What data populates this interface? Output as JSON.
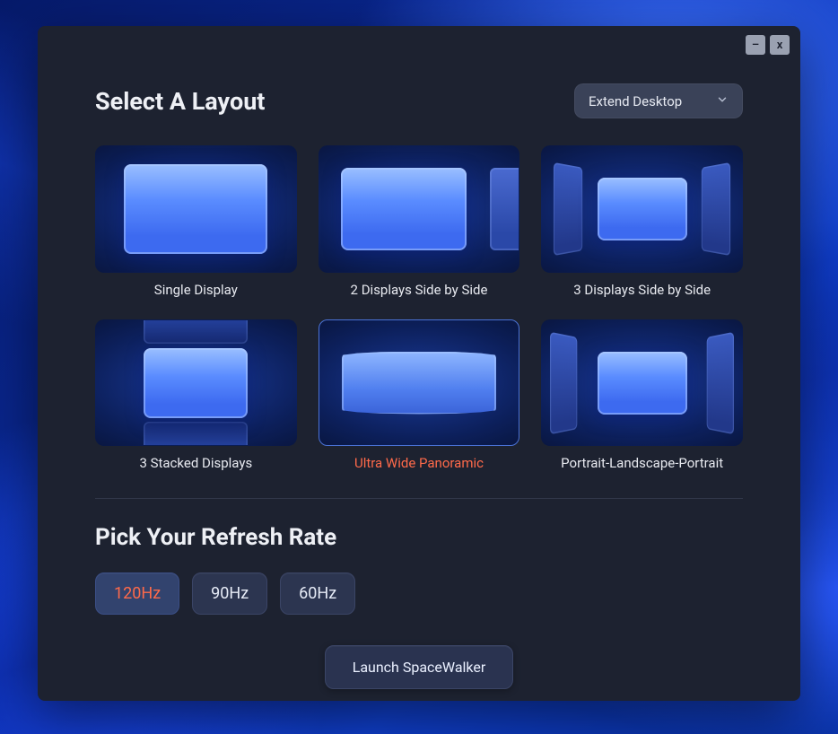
{
  "window": {
    "minimize_glyph": "–",
    "close_glyph": "x"
  },
  "header": {
    "title": "Select A Layout",
    "dropdown": {
      "selected": "Extend Desktop"
    }
  },
  "layouts": [
    {
      "key": "single",
      "label": "Single Display",
      "selected": false
    },
    {
      "key": "2side",
      "label": "2 Displays Side by Side",
      "selected": false
    },
    {
      "key": "3side",
      "label": "3 Displays Side by Side",
      "selected": false
    },
    {
      "key": "3stack",
      "label": "3 Stacked Displays",
      "selected": false
    },
    {
      "key": "uw",
      "label": "Ultra Wide Panoramic",
      "selected": true
    },
    {
      "key": "plp",
      "label": "Portrait-Landscape-Portrait",
      "selected": false
    }
  ],
  "refresh": {
    "title": "Pick Your Refresh Rate",
    "rates": [
      {
        "label": "120Hz",
        "selected": true
      },
      {
        "label": "90Hz",
        "selected": false
      },
      {
        "label": "60Hz",
        "selected": false
      }
    ]
  },
  "launch": {
    "label": "Launch SpaceWalker"
  }
}
